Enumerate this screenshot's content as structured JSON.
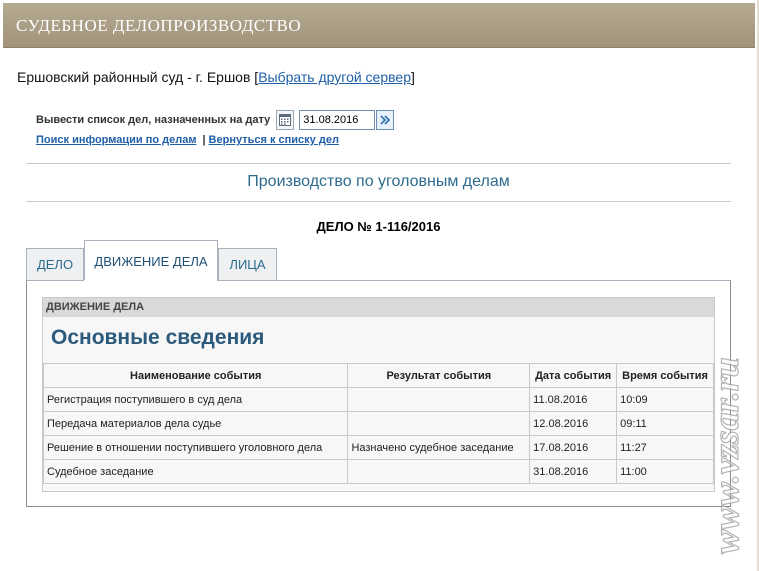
{
  "header": {
    "title": "СУДЕБНОЕ ДЕЛОПРОИЗВОДСТВО"
  },
  "court": {
    "name": "Ершовский районный суд - г. Ершов",
    "bracket_open": "[",
    "change_server_link": "Выбрать другой сервер",
    "bracket_close": "]"
  },
  "date_filter": {
    "label": "Вывести список дел, назначенных на дату",
    "value": "31.08.2016",
    "calendar_icon": "calendar-icon",
    "go_icon": "double-chevron-right-icon"
  },
  "links": {
    "search": "Поиск информации по делам",
    "separator": "|",
    "back": "Вернуться к списку дел"
  },
  "section_title": "Производство по уголовным делам",
  "case_title": "ДЕЛО № 1-116/2016",
  "tabs": [
    {
      "label": "ДЕЛО",
      "active": false
    },
    {
      "label": "ДВИЖЕНИЕ ДЕЛА",
      "active": true
    },
    {
      "label": "ЛИЦА",
      "active": false
    }
  ],
  "panel": {
    "header": "ДВИЖЕНИЕ ДЕЛА",
    "title": "Основные сведения",
    "columns": [
      "Наименование события",
      "Результат события",
      "Дата события",
      "Время события"
    ],
    "rows": [
      [
        "Регистрация поступившего в суд дела",
        "",
        "11.08.2016",
        "10:09"
      ],
      [
        "Передача материалов дела судье",
        "",
        "12.08.2016",
        "09:11"
      ],
      [
        "Решение в отношении поступившего уголовного дела",
        "Назначено судебное заседание",
        "17.08.2016",
        "11:27"
      ],
      [
        "Судебное заседание",
        "",
        "31.08.2016",
        "11:00"
      ]
    ]
  },
  "watermark": {
    "text": "www.vzsar.ru"
  },
  "colors": {
    "header_bg": "#a89a80",
    "link": "#1f5fa8",
    "section_title": "#2c6b8e",
    "panel_title": "#2c5a7d"
  }
}
